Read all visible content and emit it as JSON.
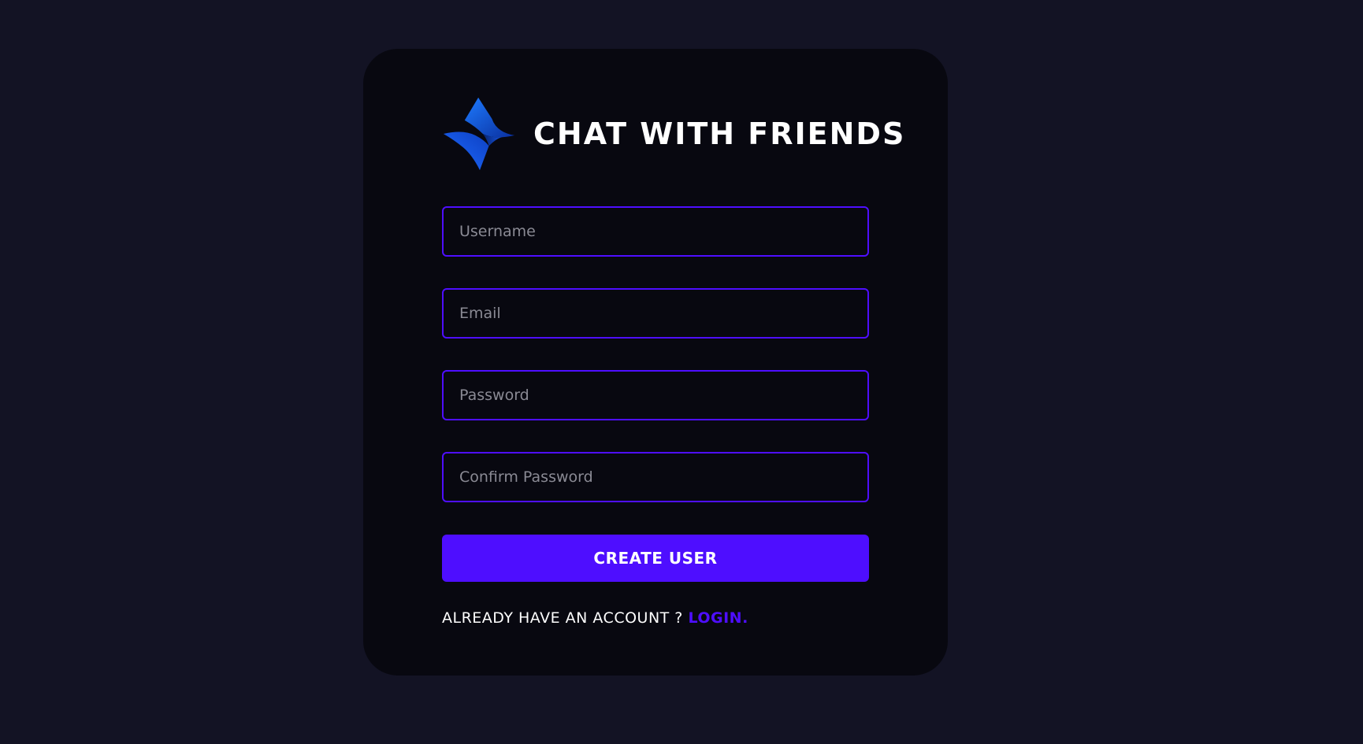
{
  "brand": {
    "title": "CHAT WITH FRIENDS",
    "logo_icon": "snap-logo-icon"
  },
  "form": {
    "username": {
      "placeholder": "Username",
      "value": ""
    },
    "email": {
      "placeholder": "Email",
      "value": ""
    },
    "password": {
      "placeholder": "Password",
      "value": ""
    },
    "confirm_password": {
      "placeholder": "Confirm Password",
      "value": ""
    },
    "submit_label": "CREATE USER"
  },
  "footer": {
    "prompt": "ALREADY HAVE AN ACCOUNT ? ",
    "login_label": "LOGIN."
  },
  "colors": {
    "page_background": "#131324",
    "card_background": "#080810",
    "accent": "#4e0eff",
    "logo_blue": "#1565ff",
    "text": "#ffffff",
    "placeholder": "#8a8a94"
  }
}
